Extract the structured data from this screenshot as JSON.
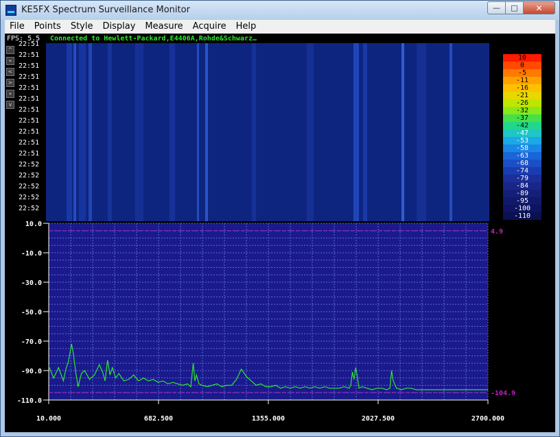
{
  "window": {
    "title": "KE5FX Spectrum Surveillance Monitor",
    "min_glyph": "—",
    "max_glyph": "□",
    "close_glyph": "✕"
  },
  "menu": [
    "File",
    "Points",
    "Style",
    "Display",
    "Measure",
    "Acquire",
    "Help"
  ],
  "status": {
    "fps": "FPS: 5.5",
    "connection": "Connected to Hewlett-Packard,E4406A,Rohde&Schwarz…"
  },
  "nav_buttons": [
    "^",
    "«",
    "<",
    ">",
    "»",
    "v"
  ],
  "waterfall": {
    "time_labels": [
      "22:51",
      "22:51",
      "22:51",
      "22:51",
      "22:51",
      "22:51",
      "22:51",
      "22:51",
      "22:51",
      "22:51",
      "22:51",
      "22:52",
      "22:52",
      "22:52",
      "22:52",
      "22:52"
    ]
  },
  "legend": {
    "values": [
      "10",
      "0",
      "-5",
      "-11",
      "-16",
      "-21",
      "-26",
      "-32",
      "-37",
      "-42",
      "-47",
      "-53",
      "-58",
      "-63",
      "-68",
      "-74",
      "-79",
      "-84",
      "-89",
      "-95",
      "-100",
      "-110"
    ],
    "colors": [
      "#ff1a00",
      "#ff4a00",
      "#ff7a00",
      "#ffa200",
      "#ffc000",
      "#e6d800",
      "#bfe600",
      "#8ae81a",
      "#45e04a",
      "#22d68a",
      "#1ec6c6",
      "#1aa8e6",
      "#1a86e6",
      "#1a66d8",
      "#1a4fc6",
      "#1a3cae",
      "#1a2f9a",
      "#1a2588",
      "#141f78",
      "#10196a",
      "#0e1460",
      "#0a1050"
    ]
  },
  "chart_data": {
    "type": "line",
    "xlim": [
      10.0,
      2700.0
    ],
    "ylim": [
      -110.0,
      10.0
    ],
    "x_ticks": [
      "10.000",
      "682.500",
      "1355.000",
      "2027.500",
      "2700.000"
    ],
    "y_ticks": [
      "10.0",
      "-10.0",
      "-30.0",
      "-50.0",
      "-70.0",
      "-90.0",
      "-110.0"
    ],
    "markers": [
      {
        "label": "4.9",
        "value": 4.9,
        "color": "#c020c0"
      },
      {
        "label": "-104.9",
        "value": -104.9,
        "color": "#c020c0"
      }
    ],
    "series": [
      {
        "color": "#2ee82e",
        "x": [
          10,
          40,
          70,
          100,
          115,
          130,
          150,
          160,
          175,
          190,
          210,
          230,
          260,
          290,
          320,
          340,
          355,
          370,
          385,
          400,
          420,
          440,
          470,
          500,
          530,
          560,
          590,
          620,
          650,
          680,
          710,
          740,
          770,
          800,
          830,
          860,
          880,
          895,
          905,
          915,
          930,
          950,
          980,
          1010,
          1040,
          1070,
          1100,
          1130,
          1160,
          1190,
          1220,
          1250,
          1280,
          1310,
          1340,
          1370,
          1400,
          1430,
          1460,
          1490,
          1520,
          1550,
          1580,
          1610,
          1640,
          1670,
          1700,
          1730,
          1760,
          1790,
          1820,
          1850,
          1860,
          1870,
          1880,
          1890,
          1900,
          1910,
          1930,
          1960,
          1990,
          2020,
          2050,
          2080,
          2100,
          2110,
          2120,
          2140,
          2170,
          2200,
          2230,
          2260,
          2290,
          2320,
          2350,
          2380,
          2410,
          2440,
          2470,
          2500,
          2530,
          2560,
          2590,
          2620,
          2650,
          2680,
          2700
        ],
        "y": [
          -87,
          -95,
          -88,
          -97,
          -89,
          -84,
          -72,
          -78,
          -91,
          -101,
          -92,
          -90,
          -96,
          -93,
          -86,
          -91,
          -97,
          -83,
          -93,
          -88,
          -95,
          -92,
          -97,
          -96,
          -93,
          -97,
          -95,
          -97,
          -96,
          -98,
          -97,
          -99,
          -98,
          -99,
          -100,
          -99,
          -101,
          -85,
          -97,
          -93,
          -99,
          -100,
          -101,
          -100,
          -99,
          -101,
          -100,
          -100,
          -96,
          -89,
          -94,
          -97,
          -100,
          -99,
          -101,
          -101,
          -100,
          -102,
          -101,
          -102,
          -101,
          -102,
          -101,
          -102,
          -101,
          -102,
          -101,
          -102,
          -102,
          -102,
          -101,
          -102,
          -100,
          -91,
          -96,
          -88,
          -94,
          -102,
          -101,
          -102,
          -103,
          -102,
          -102,
          -103,
          -102,
          -90,
          -97,
          -102,
          -103,
          -102,
          -102,
          -103,
          -103,
          -103,
          -103,
          -103,
          -103,
          -103,
          -103,
          -103,
          -103,
          -103,
          -103,
          -103,
          -103,
          -103,
          -103
        ]
      }
    ]
  }
}
